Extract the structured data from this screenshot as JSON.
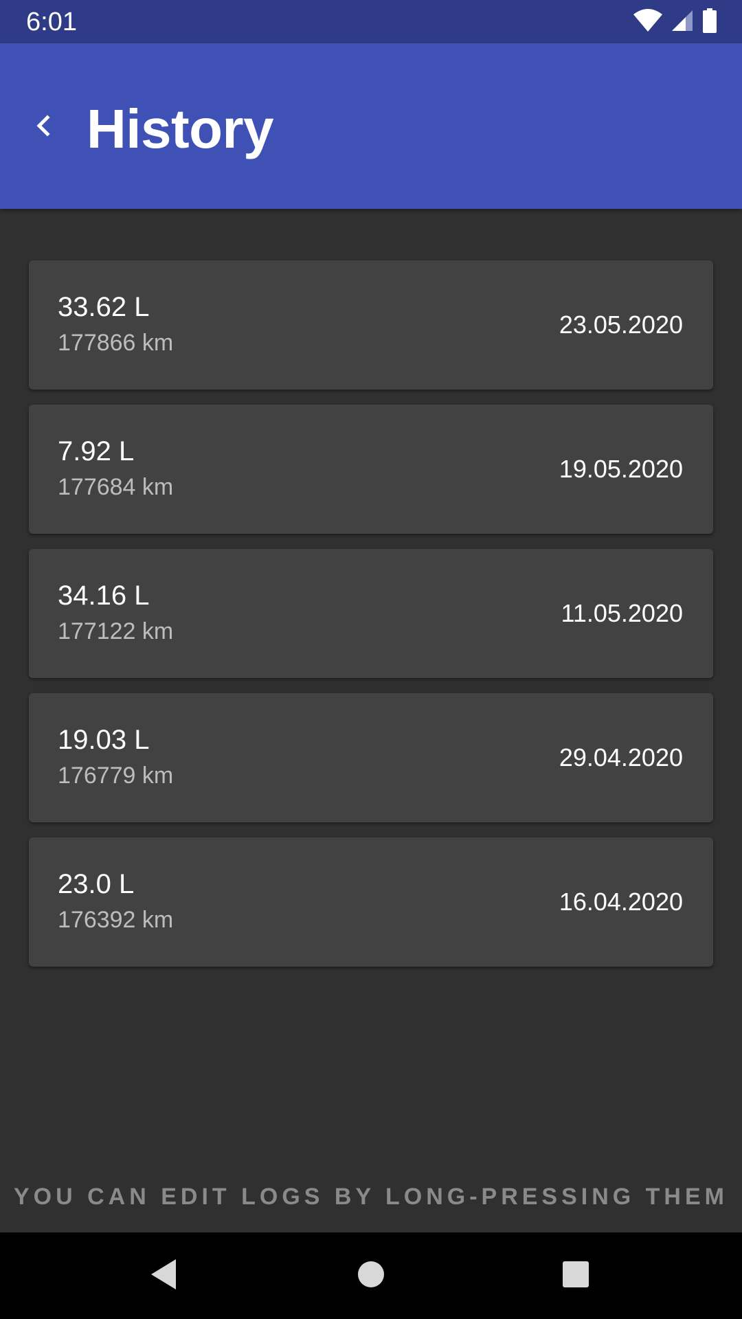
{
  "status_bar": {
    "time": "6:01",
    "icons": [
      "wifi-icon",
      "cell-signal-icon",
      "battery-icon"
    ]
  },
  "app_bar": {
    "title": "History",
    "back_icon": "chevron-left-icon",
    "color": "#3f51b5"
  },
  "logs": [
    {
      "volume": "33.62 L",
      "distance": "177866 km",
      "date": "23.05.2020"
    },
    {
      "volume": "7.92 L",
      "distance": "177684 km",
      "date": "19.05.2020"
    },
    {
      "volume": "34.16 L",
      "distance": "177122 km",
      "date": "11.05.2020"
    },
    {
      "volume": "19.03 L",
      "distance": "176779 km",
      "date": "29.04.2020"
    },
    {
      "volume": "23.0 L",
      "distance": "176392 km",
      "date": "16.04.2020"
    }
  ],
  "hint": "YOU CAN EDIT LOGS BY LONG-PRESSING THEM",
  "nav_bar": {
    "buttons": [
      "back-triangle-icon",
      "home-circle-icon",
      "recents-square-icon"
    ]
  },
  "colors": {
    "status_bar": "#2f3b86",
    "background": "#303030",
    "card": "#424242"
  }
}
